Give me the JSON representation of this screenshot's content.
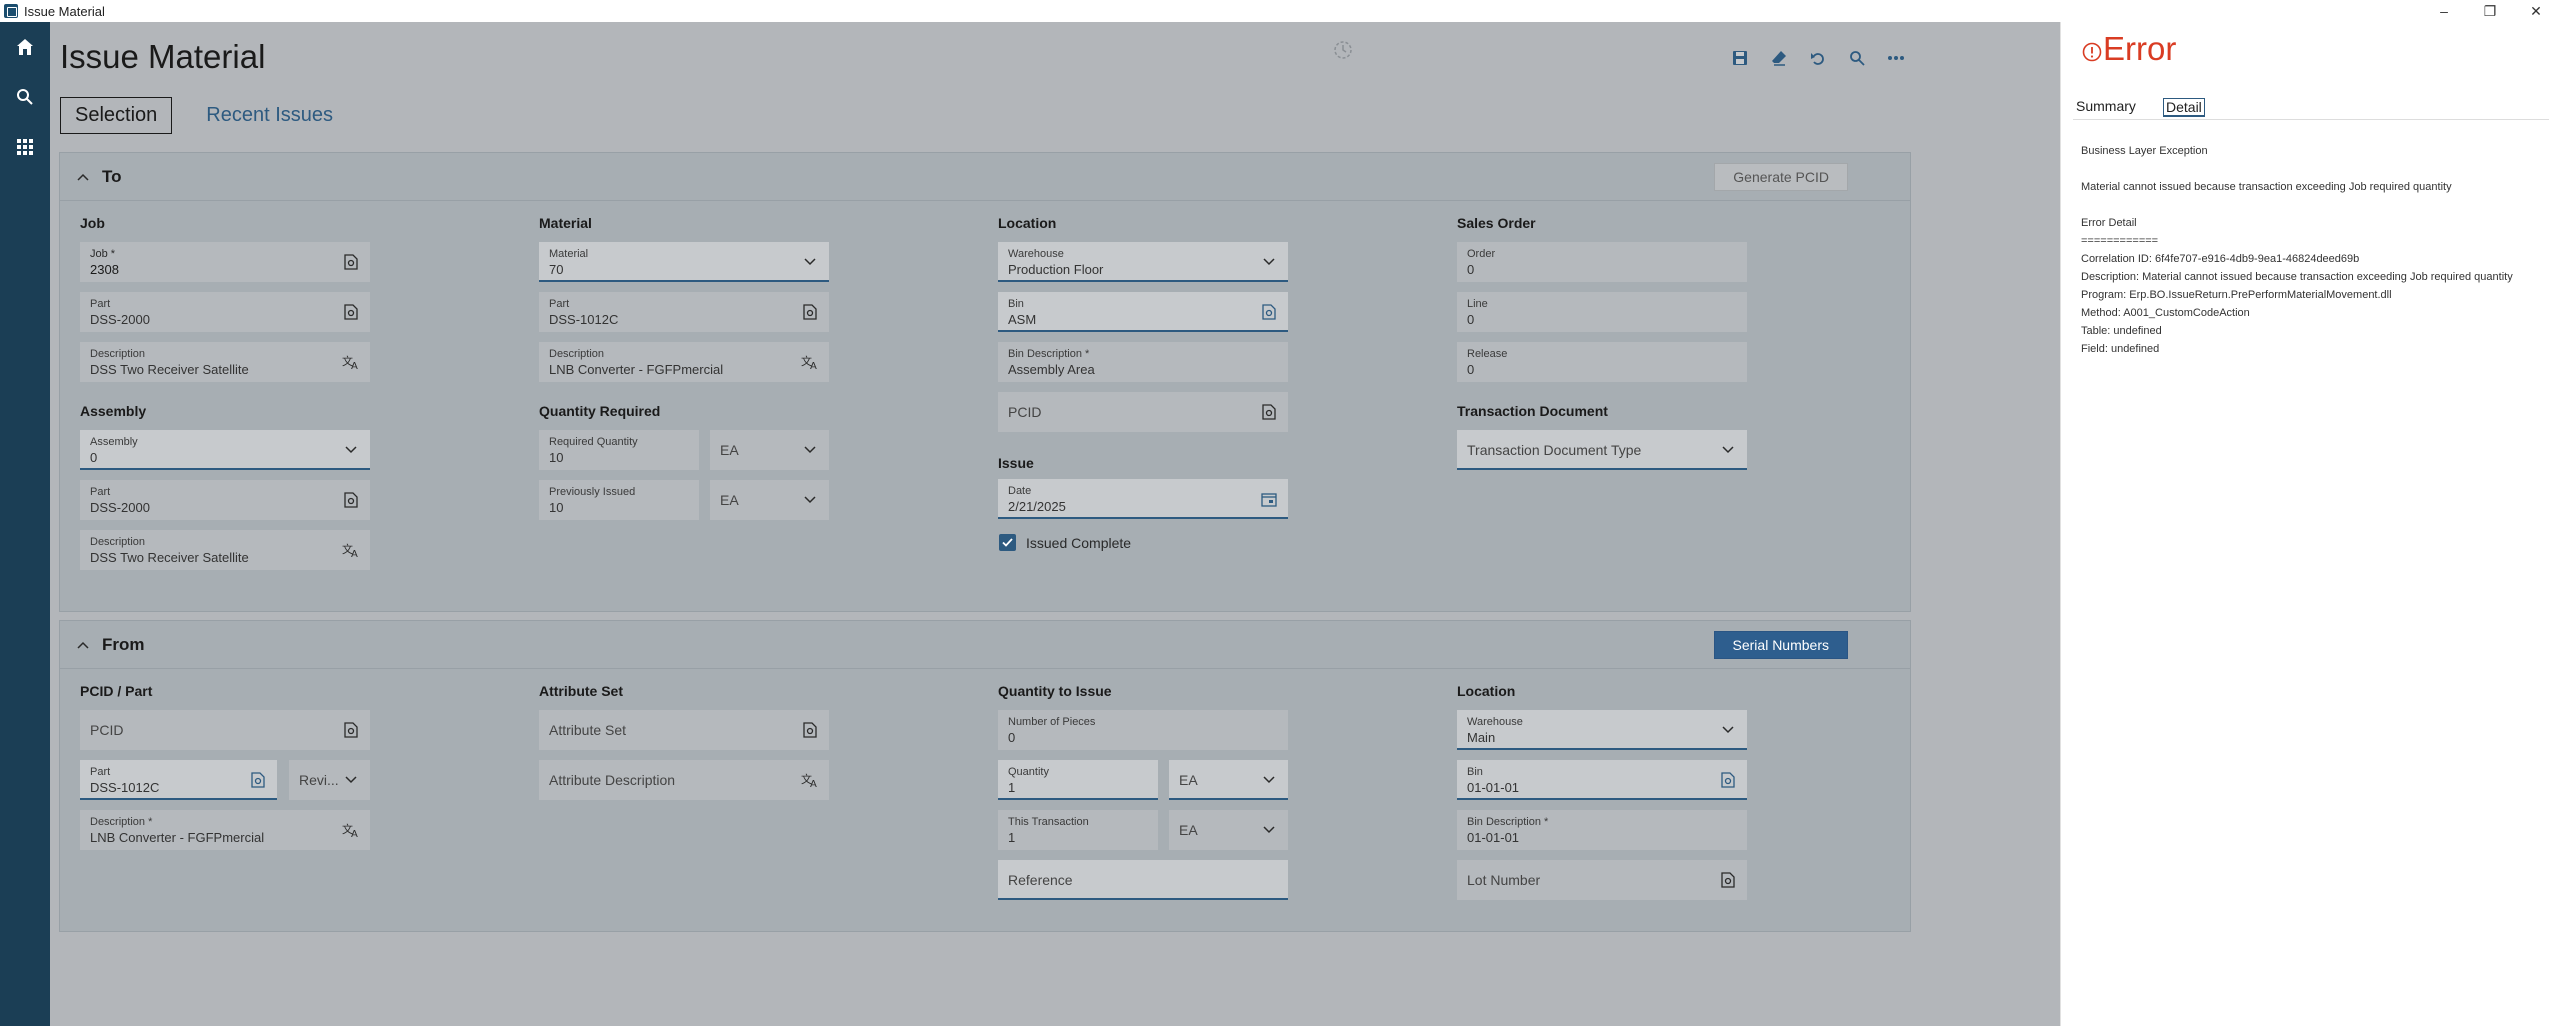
{
  "window": {
    "title": "Issue Material",
    "buttons": [
      "–",
      "❐",
      "✕"
    ]
  },
  "leftnav": {
    "items": [
      "home-icon",
      "search-icon",
      "apps-icon"
    ]
  },
  "page": {
    "title": "Issue Material"
  },
  "toolbar": {
    "icons": [
      "save-icon",
      "clear-icon",
      "undo-icon",
      "search-icon",
      "more-icon"
    ]
  },
  "tabs": [
    {
      "label": "Selection",
      "active": true
    },
    {
      "label": "Recent Issues",
      "active": false
    }
  ],
  "to": {
    "title": "To",
    "generate_btn": "Generate PCID",
    "job": {
      "section": "Job",
      "job_label": "Job *",
      "job_value": "2308",
      "part_label": "Part",
      "part_value": "DSS-2000",
      "desc_label": "Description",
      "desc_value": "DSS Two Receiver Satellite"
    },
    "assembly": {
      "section": "Assembly",
      "asm_label": "Assembly",
      "asm_value": "0",
      "part_label": "Part",
      "part_value": "DSS-2000",
      "desc_label": "Description",
      "desc_value": "DSS Two Receiver Satellite"
    },
    "material": {
      "section": "Material",
      "mat_label": "Material",
      "mat_value": "70",
      "part_label": "Part",
      "part_value": "DSS-1012C",
      "desc_label": "Description",
      "desc_value": "LNB Converter - FGFPmercial"
    },
    "qty_required": {
      "section": "Quantity Required",
      "req_label": "Required Quantity",
      "req_value": "10",
      "req_uom": "EA",
      "prev_label": "Previously Issued",
      "prev_value": "10",
      "prev_uom": "EA"
    },
    "location": {
      "section": "Location",
      "wh_label": "Warehouse",
      "wh_value": "Production Floor",
      "bin_label": "Bin",
      "bin_value": "ASM",
      "bindesc_label": "Bin Description *",
      "bindesc_value": "Assembly Area",
      "pcid_placeholder": "PCID"
    },
    "issue": {
      "section": "Issue",
      "date_label": "Date",
      "date_value": "2/21/2025",
      "complete_label": "Issued Complete",
      "complete_checked": true
    },
    "sales_order": {
      "section": "Sales Order",
      "order_label": "Order",
      "order_value": "0",
      "line_label": "Line",
      "line_value": "0",
      "release_label": "Release",
      "release_value": "0"
    },
    "transaction_doc": {
      "section": "Transaction Document",
      "placeholder": "Transaction Document Type"
    }
  },
  "from": {
    "title": "From",
    "serial_btn": "Serial Numbers",
    "pcid_part": {
      "section": "PCID / Part",
      "pcid_placeholder": "PCID",
      "part_label": "Part",
      "part_value": "DSS-1012C",
      "rev_placeholder": "Revi...",
      "desc_label": "Description *",
      "desc_value": "LNB Converter - FGFPmercial"
    },
    "attribute_set": {
      "section": "Attribute Set",
      "set_placeholder": "Attribute Set",
      "desc_placeholder": "Attribute Description"
    },
    "qty_issue": {
      "section": "Quantity to Issue",
      "pieces_label": "Number of Pieces",
      "pieces_value": "0",
      "qty_label": "Quantity",
      "qty_value": "1",
      "qty_uom": "EA",
      "trans_label": "This Transaction",
      "trans_value": "1",
      "trans_uom": "EA",
      "ref_placeholder": "Reference"
    },
    "location": {
      "section": "Location",
      "wh_label": "Warehouse",
      "wh_value": "Main",
      "bin_label": "Bin",
      "bin_value": "01-01-01",
      "bindesc_label": "Bin Description *",
      "bindesc_value": "01-01-01",
      "lot_placeholder": "Lot Number"
    }
  },
  "error": {
    "title": "Error",
    "tabs": [
      {
        "label": "Summary",
        "active": false
      },
      {
        "label": "Detail",
        "active": true
      }
    ],
    "lines": [
      "Business Layer Exception",
      "",
      "Material cannot issued because transaction exceeding Job required quantity",
      "",
      "Error Detail",
      "============",
      "Correlation ID: 6f4fe707-e916-4db9-9ea1-46824deed69b",
      "Description: Material cannot issued because transaction exceeding Job required quantity",
      "Program: Erp.BO.IssueReturn.PrePerformMaterialMovement.dll",
      "Method: A001_CustomCodeAction",
      "Table: undefined",
      "Field: undefined"
    ]
  },
  "colors": {
    "nav": "#1b3e55",
    "accent": "#2d5a80",
    "error": "#d93c23",
    "overlay": "#b3b6ba"
  }
}
